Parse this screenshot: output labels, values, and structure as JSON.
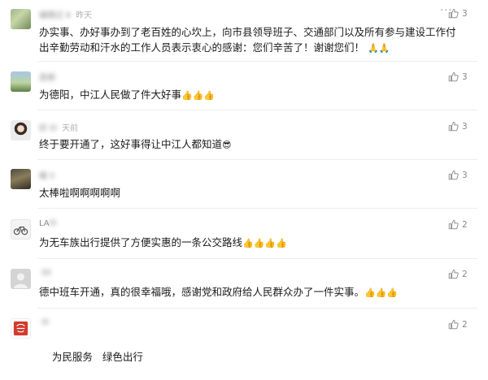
{
  "comments": [
    {
      "name": "编辑过",
      "time": "昨天",
      "time_blurred": false,
      "text": "办实事、办好事办到了老百姓的心坎上，向市县领导班子、交通部门以及所有参与建设工作付出辛勤劳动和汗水的工作人员表示衷心的感谢：您们辛苦了！谢谢您们！",
      "emoji": "🙏🙏",
      "likes": "3",
      "has_more_menu": true
    },
    {
      "name": "息柳",
      "time": "",
      "time_blurred": false,
      "text": "为德阳，中江人民做了件大好事",
      "emoji": "👍👍👍",
      "likes": "3",
      "has_more_menu": false
    },
    {
      "name": "好",
      "time": "天前",
      "time_blurred": true,
      "text": "终于要开通了，这好事得让中江人都知道",
      "emoji": "😎",
      "likes": "3",
      "has_more_menu": false
    },
    {
      "name": "暖",
      "time": "",
      "time_blurred": false,
      "text": "太棒啦啊啊啊啊啊",
      "emoji": "",
      "likes": "3",
      "has_more_menu": false
    },
    {
      "name": "LA",
      "time": "",
      "time_blurred": false,
      "text": "为无车族出行提供了方便实惠的一条公交路线",
      "emoji": "👍👍👍👍",
      "likes": "2",
      "has_more_menu": false
    },
    {
      "name": "",
      "time": "",
      "time_blurred": false,
      "text": "德中班车开通，真的很幸福哦，感谢党和政府给人民群众办了一件实事。",
      "emoji": "👍👍👍",
      "likes": "2",
      "has_more_menu": false
    },
    {
      "name": "",
      "time": "",
      "time_blurred": false,
      "text": "为民服务   绿色出行",
      "emoji": "",
      "likes": "2",
      "has_more_menu": false
    }
  ]
}
